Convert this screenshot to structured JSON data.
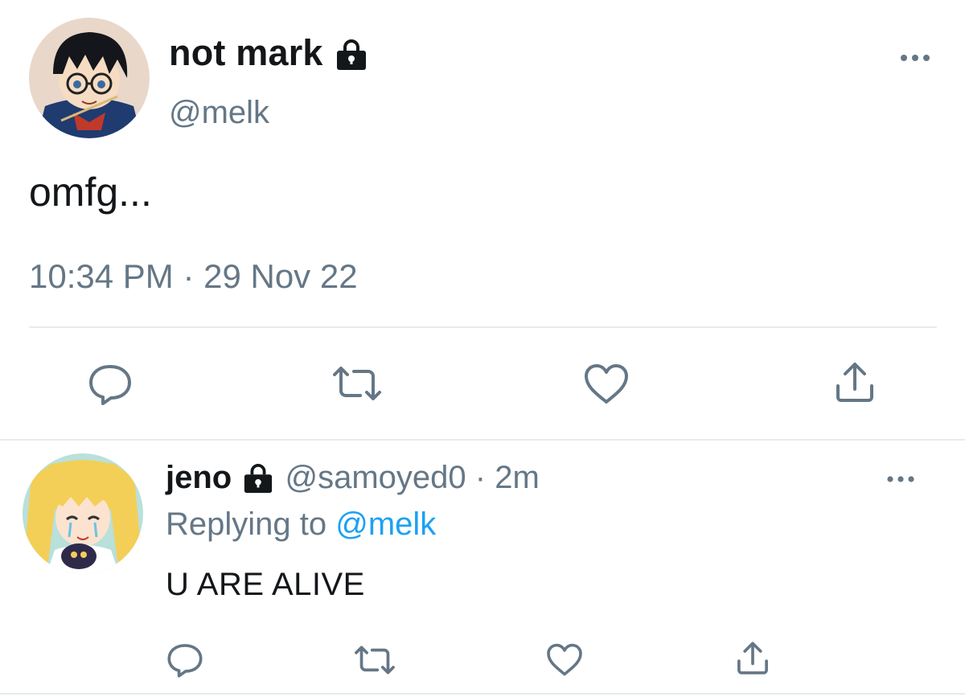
{
  "main_tweet": {
    "display_name": "not mark",
    "handle": "@melk",
    "text": "omfg...",
    "timestamp": "10:34 PM · 29 Nov 22",
    "icons": {
      "lock": "lock-icon",
      "more": "more-icon",
      "reply": "reply-icon",
      "retweet": "retweet-icon",
      "like": "like-icon",
      "share": "share-icon"
    }
  },
  "reply_tweet": {
    "display_name": "jeno",
    "handle": "@samoyed0",
    "separator": "·",
    "time_ago": "2m",
    "replying_label": "Replying to",
    "replying_to": "@melk",
    "text": "U ARE ALIVE"
  },
  "colors": {
    "text": "#14171a",
    "muted": "#657786",
    "link": "#1da1f2",
    "divider": "#e6ecf0",
    "icon": "#657786"
  }
}
